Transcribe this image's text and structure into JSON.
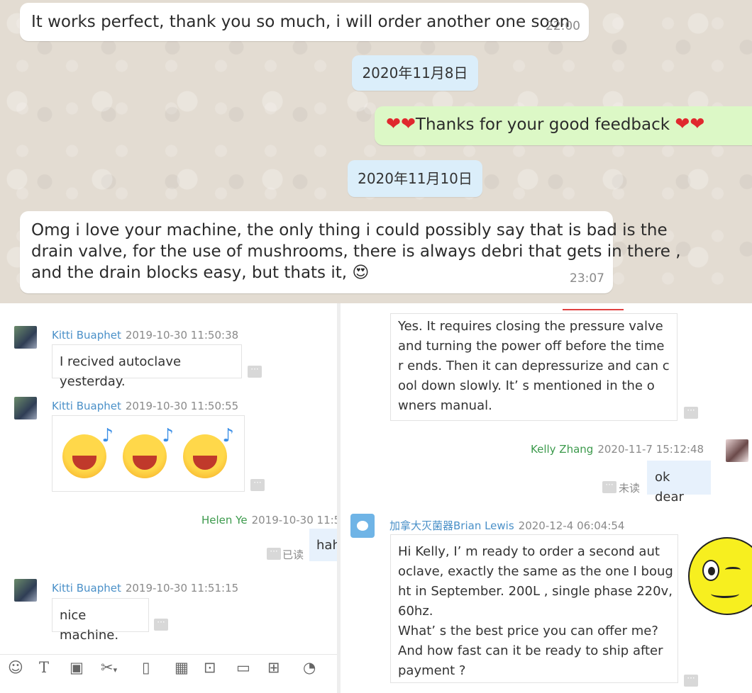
{
  "whatsapp": {
    "messages": [
      {
        "text": "It works perfect, thank you so much, i will order another one soon",
        "time": "22:00"
      },
      {
        "date": "2020年11月8日"
      },
      {
        "text": "Thanks for your good feedback",
        "hearts": "❤❤"
      },
      {
        "date": "2020年11月10日"
      },
      {
        "lines": [
          "Omg i love your machine, the only thing i could possibly say that is bad is the",
          "drain valve, for the use of mushrooms, there is always debri that gets in there ,",
          "and the drain blocks easy, but thats it,"
        ],
        "emoji": "😍",
        "time": "23:07"
      }
    ]
  },
  "left_chat": {
    "messages": [
      {
        "sender": "Kitti Buaphet",
        "timestamp": "2019-10-30 11:50:38",
        "text": "I recived autoclave yesterday."
      },
      {
        "sender": "Kitti Buaphet",
        "timestamp": "2019-10-30 11:50:55",
        "emoji_count": 3
      },
      {
        "sender": "Helen Ye",
        "timestamp": "2019-10-30 11:5",
        "text": "hah",
        "status": "已读"
      },
      {
        "sender": "Kitti Buaphet",
        "timestamp": "2019-10-30 11:51:15",
        "text": "nice machine."
      }
    ],
    "toolbar": [
      "smile-icon",
      "text-icon",
      "image-icon",
      "scissors-icon",
      "vibrate-icon",
      "calendar-icon",
      "screenshot-icon",
      "folder-icon",
      "apps-icon",
      "history-icon"
    ]
  },
  "right_chat": {
    "messages": [
      {
        "lines": [
          "Yes. It requires closing the pressure valve",
          "and  turning the power off before the time",
          "r ends. Then it can depressurize and can c",
          "ool down slowly. It’ s mentioned in the o",
          "wners manual."
        ]
      },
      {
        "sender": "Kelly Zhang",
        "timestamp": "2020-11-7 15:12:48",
        "text": "ok dear",
        "status": "未读"
      },
      {
        "sender": "加拿大灭菌器Brian Lewis",
        "timestamp": "2020-12-4 06:04:54",
        "lines": [
          "Hi Kelly, I’ m ready to order a second aut",
          "oclave, exactly the same as the one I boug",
          "ht in September.  200L , single phase 220v,",
          " 60hz.",
          "What’ s the best price you can offer me?",
          "And how fast can it be ready to ship after",
          "payment ?"
        ]
      }
    ]
  }
}
